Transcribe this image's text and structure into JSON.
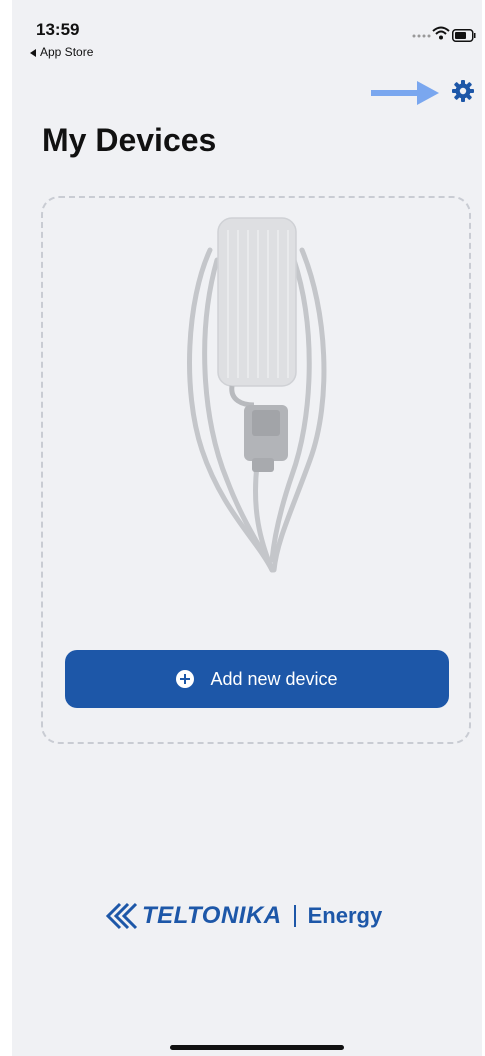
{
  "status_bar": {
    "time": "13:59",
    "back_label": "App Store"
  },
  "header": {
    "title": "My Devices"
  },
  "add_device": {
    "label": "Add new device"
  },
  "brand": {
    "name": "TELTONIKA",
    "product": "Energy",
    "color": "#1d57a8"
  },
  "icons": {
    "settings": "gear-icon",
    "arrow": "arrow-right-icon",
    "add": "plus-circle-icon"
  },
  "colors": {
    "accent": "#1d57a8",
    "arrow": "#7aa7ef",
    "background": "#f0f1f4"
  }
}
